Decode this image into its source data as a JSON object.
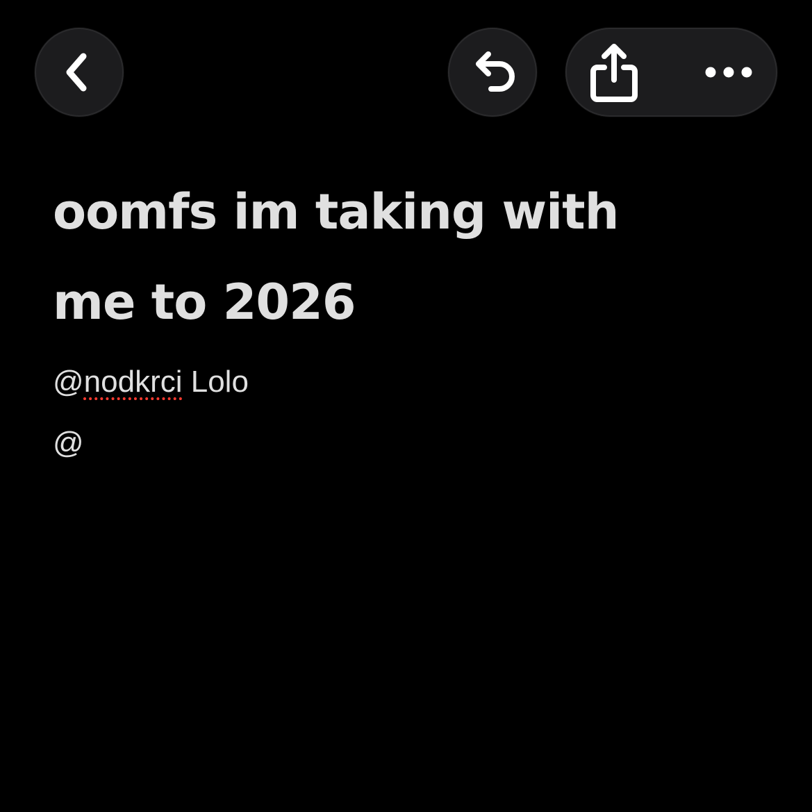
{
  "toolbar": {
    "back_icon": "chevron-left-icon",
    "undo_icon": "undo-arrow-icon",
    "share_icon": "share-icon",
    "more_icon": "ellipsis-icon"
  },
  "note": {
    "title": "oomfs im taking with me to 2026",
    "line1": {
      "at": "@",
      "mention": "nodkrci",
      "name": " Lolo"
    },
    "line2": "@"
  },
  "colors": {
    "background": "#000000",
    "button_bg": "#1c1c1e",
    "text": "#e0e0e0",
    "spellcheck": "#ff3b30"
  }
}
